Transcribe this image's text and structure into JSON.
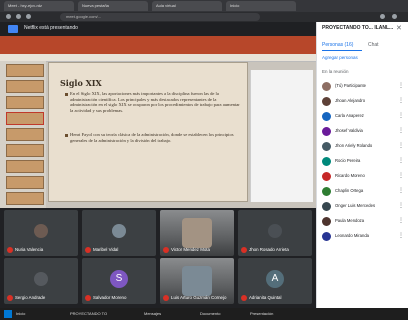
{
  "browser": {
    "tabs": [
      "Meet - hxy-ejcv-rdz",
      "Nueva pestaña",
      "Aula virtual",
      "Inicio"
    ],
    "url": "meet.google.com/..."
  },
  "meet": {
    "title": "Netflix está presentando"
  },
  "slide": {
    "title": "Siglo XIX",
    "paragraphs": [
      "En el Siglo XIX, las aportaciones más importantes a la disciplina fueron las de la administración científica. Los principales y más destacados representantes de la administración en el siglo XIX se ocuparon por los procedimientos de trabajo para aumentar la actividad y sus problemas.",
      "Henri Fayol con su teoría clásica de la administración, donde se establecen los principios generales de la administración y la división del trabajo."
    ]
  },
  "side_panel": {
    "title": "PROYECTANDO TO... ILANL...",
    "people_tab": "Personas (16)",
    "chat_tab": "Chat",
    "add_people": "Agregar personas",
    "list_label": "En la reunión",
    "participants": [
      {
        "name": "(Tú) Participante",
        "color": "#8d6e63"
      },
      {
        "name": "Jhoan Alejandro",
        "color": "#5d4037"
      },
      {
        "name": "Carla Anaperez",
        "color": "#1565c0"
      },
      {
        "name": "Jhosef Valdivia",
        "color": "#6a1b9a"
      },
      {
        "name": "Jhon Ariely Rolando",
        "color": "#455a64"
      },
      {
        "name": "Rocio Pereira",
        "color": "#00897b"
      },
      {
        "name": "Ricardo Moreno",
        "color": "#c62828"
      },
      {
        "name": "Chaplin Ortega",
        "color": "#2e7d32"
      },
      {
        "name": "Onger Luis Mercedes",
        "color": "#37474f"
      },
      {
        "name": "Paula Mendoza",
        "color": "#4e342e"
      },
      {
        "name": "Leonardo Miranda",
        "color": "#283593"
      }
    ]
  },
  "tiles": [
    {
      "name": "Nuria Valencia",
      "type": "photo"
    },
    {
      "name": "Maribel Vidal",
      "type": "photo"
    },
    {
      "name": "Victor Mendez Mota",
      "type": "camera"
    },
    {
      "name": "Jhon Rosado Arrieta",
      "type": "photo"
    },
    {
      "name": "Sergio Andrade",
      "type": "photo"
    },
    {
      "name": "Salvador Moreno",
      "type": "avatar",
      "letter": "S",
      "color": "#7e57c2"
    },
    {
      "name": "Luis Arturo Guzmán Cornejo",
      "type": "camera"
    },
    {
      "name": "Adrianita Quintal",
      "type": "avatar",
      "letter": "A",
      "color": "#546e7a"
    }
  ],
  "taskbar": {
    "items": [
      "Inicio",
      "PROYECTANDO TO",
      "Mensajes",
      "Documento",
      "Presentación"
    ]
  }
}
